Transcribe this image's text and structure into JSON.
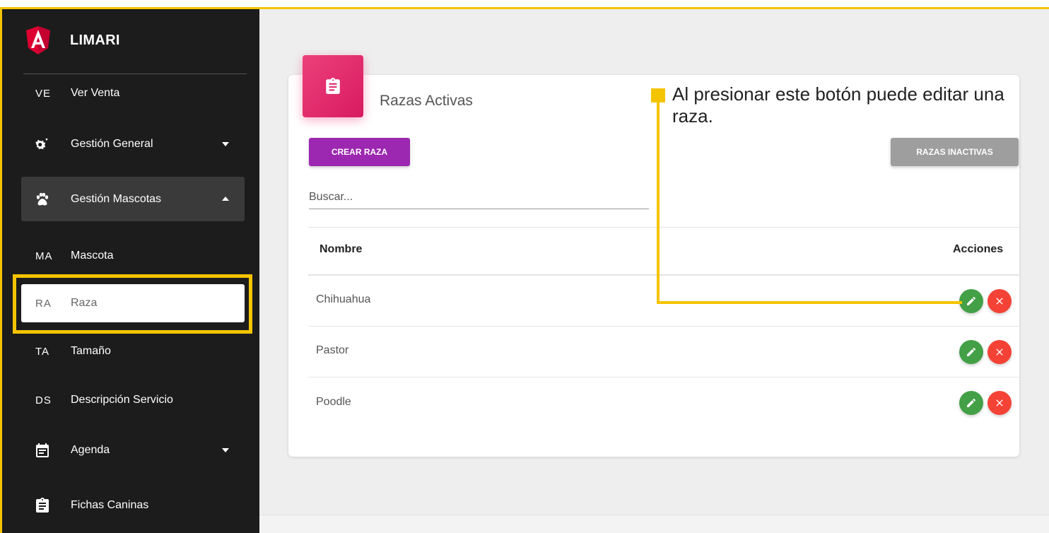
{
  "brand": {
    "name": "LIMARI",
    "logo_icon": "angular-logo-icon",
    "logo_color": "#dd0031"
  },
  "sidebar": {
    "items": [
      {
        "abbr": "VE",
        "label": "Ver Venta"
      },
      {
        "icon": "gears-icon",
        "label": "Gestión General",
        "caret": "down"
      },
      {
        "icon": "paw-icon",
        "label": "Gestión Mascotas",
        "caret": "up",
        "expanded": true
      },
      {
        "abbr": "MA",
        "label": "Mascota"
      },
      {
        "abbr": "RA",
        "label": "Raza",
        "active": true
      },
      {
        "abbr": "TA",
        "label": "Tamaño"
      },
      {
        "abbr": "DS",
        "label": "Descripción Servicio"
      },
      {
        "icon": "calendar-icon",
        "label": "Agenda",
        "caret": "down"
      },
      {
        "icon": "clipboard-icon",
        "label": "Fichas Caninas"
      }
    ]
  },
  "card": {
    "icon": "clipboard-icon",
    "title": "Razas Activas",
    "create_button": "CREAR RAZA",
    "inactive_button": "RAZAS INACTIVAS",
    "search_placeholder": "Buscar...",
    "table": {
      "headers": {
        "name": "Nombre",
        "actions": "Acciones"
      },
      "rows": [
        {
          "name": "Chihuahua"
        },
        {
          "name": "Pastor"
        },
        {
          "name": "Poodle"
        }
      ]
    }
  },
  "annotation": {
    "text": "Al presionar este botón puede editar una raza.",
    "color": "#f5c400"
  },
  "colors": {
    "sidebar_bg": "#1c1c1c",
    "create_button": "#9c27b0",
    "inactive_button": "#9e9e9e",
    "card_icon": "#e91e63",
    "edit_action": "#43a047",
    "delete_action": "#f44336"
  }
}
